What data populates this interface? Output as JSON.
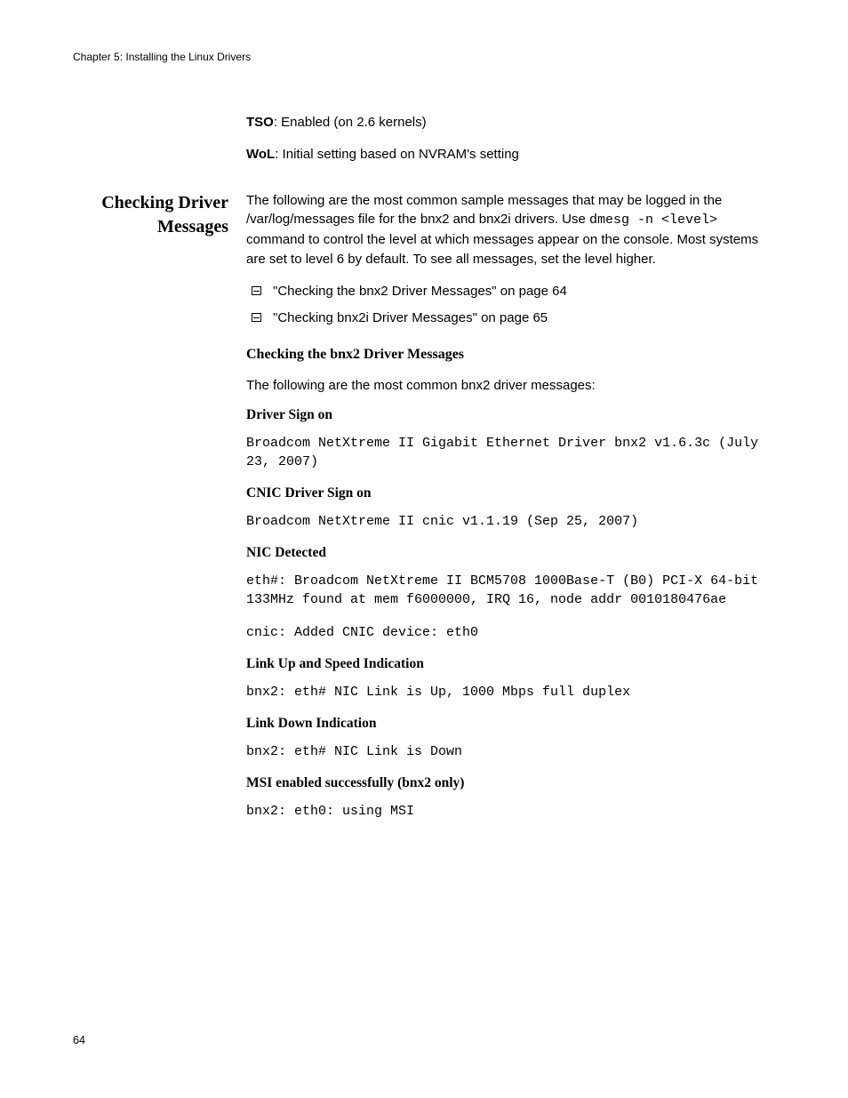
{
  "header": "Chapter 5: Installing the Linux Drivers",
  "settings": {
    "tsoLabel": "TSO",
    "tsoValue": ": Enabled (on 2.6 kernels)",
    "wolLabel": "WoL",
    "wolValue": ": Initial setting based on NVRAM's setting"
  },
  "sidebarHeading": "Checking Driver Messages",
  "intro": {
    "part1": "The following are the most common sample messages that may be logged in the /var/log/messages file for the bnx2 and bnx2i drivers. Use ",
    "cmd": "dmesg -n <level>",
    "part2": " command to control the level at which messages appear on the console. Most systems are set to level 6 by default. To see all messages, set the level higher."
  },
  "bullets": [
    "\"Checking the bnx2 Driver Messages\" on page 64",
    "\"Checking bnx2i Driver Messages\" on page 65"
  ],
  "sections": {
    "main": "Checking the bnx2 Driver Messages",
    "mainIntro": "The following are the most common bnx2 driver messages:",
    "driverSignOn": {
      "title": "Driver Sign on",
      "code": "Broadcom NetXtreme II Gigabit Ethernet Driver bnx2 v1.6.3c (July 23, 2007)"
    },
    "cnicSignOn": {
      "title": "CNIC Driver Sign on",
      "code": "Broadcom NetXtreme II cnic v1.1.19 (Sep 25, 2007)"
    },
    "nicDetected": {
      "title": "NIC Detected",
      "code1": "eth#: Broadcom NetXtreme II BCM5708 1000Base-T (B0) PCI-X 64-bit 133MHz found at mem f6000000, IRQ 16, node addr 0010180476ae",
      "code2": "cnic: Added CNIC device: eth0"
    },
    "linkUp": {
      "title": "Link Up and Speed Indication",
      "code": "bnx2: eth# NIC Link is Up, 1000 Mbps full duplex"
    },
    "linkDown": {
      "title": "Link Down Indication",
      "code": "bnx2: eth# NIC Link is Down"
    },
    "msi": {
      "title": "MSI enabled successfully (bnx2 only)",
      "code": "bnx2: eth0: using MSI"
    }
  },
  "pageNumber": "64"
}
